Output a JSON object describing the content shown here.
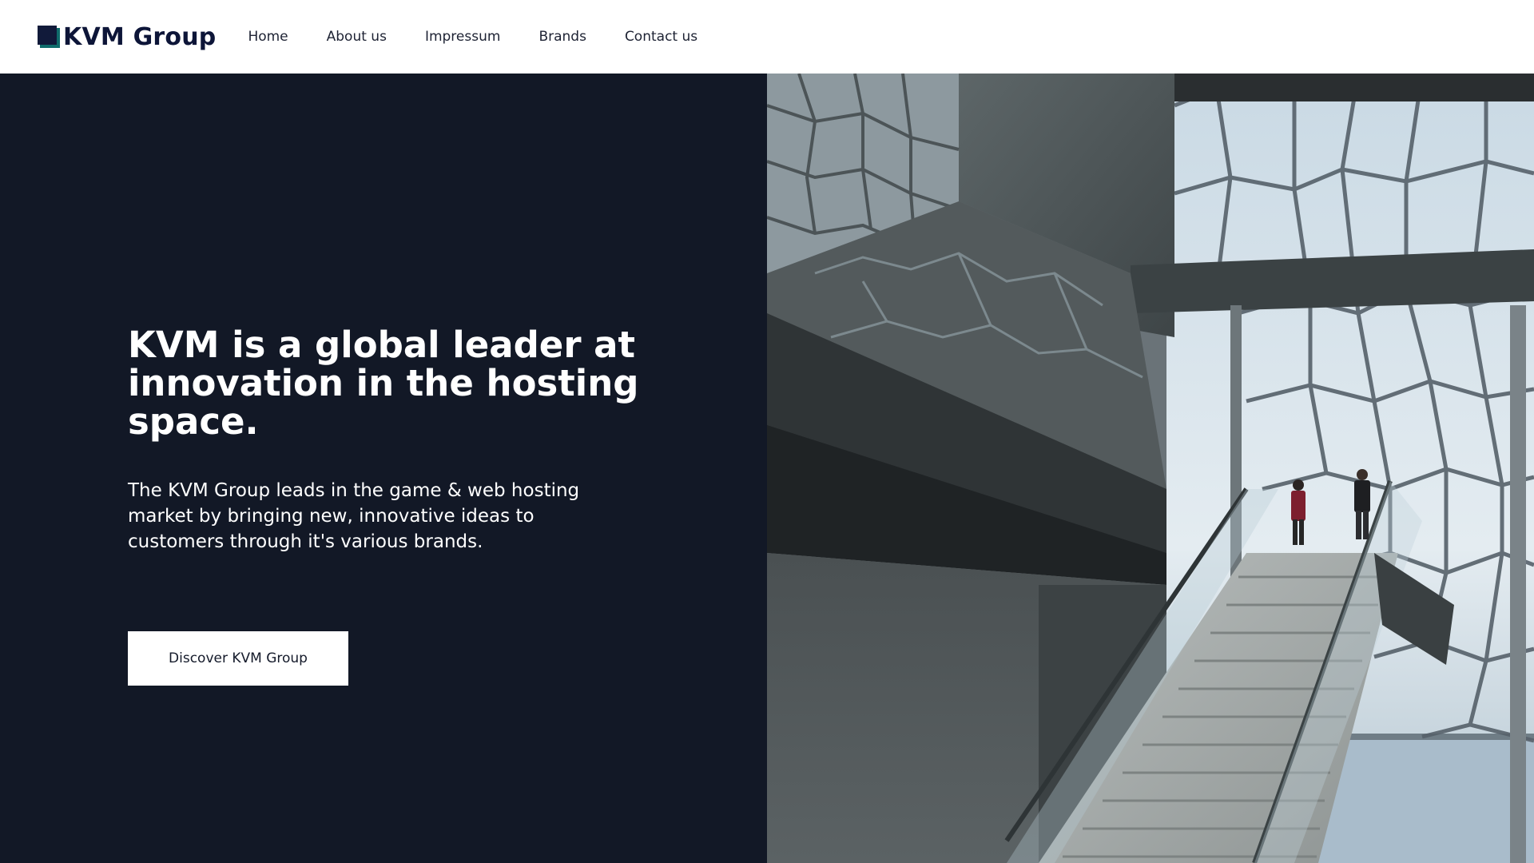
{
  "header": {
    "logo_text": "KVM Group",
    "nav": [
      {
        "label": "Home"
      },
      {
        "label": "About us"
      },
      {
        "label": "Impressum"
      },
      {
        "label": "Brands"
      },
      {
        "label": "Contact us"
      }
    ]
  },
  "hero": {
    "headline": "KVM is a global leader at innovation in the hosting space.",
    "description": "The KVM Group leads in the game & web hosting market by bringing new, innovative ideas to customers through it's various brands.",
    "cta_label": "Discover KVM Group"
  },
  "colors": {
    "hero_background": "#121826",
    "logo_primary": "#111a3a",
    "logo_accent": "#0f6b6b"
  },
  "icons": {
    "logo": "kvm-logo-icon"
  }
}
